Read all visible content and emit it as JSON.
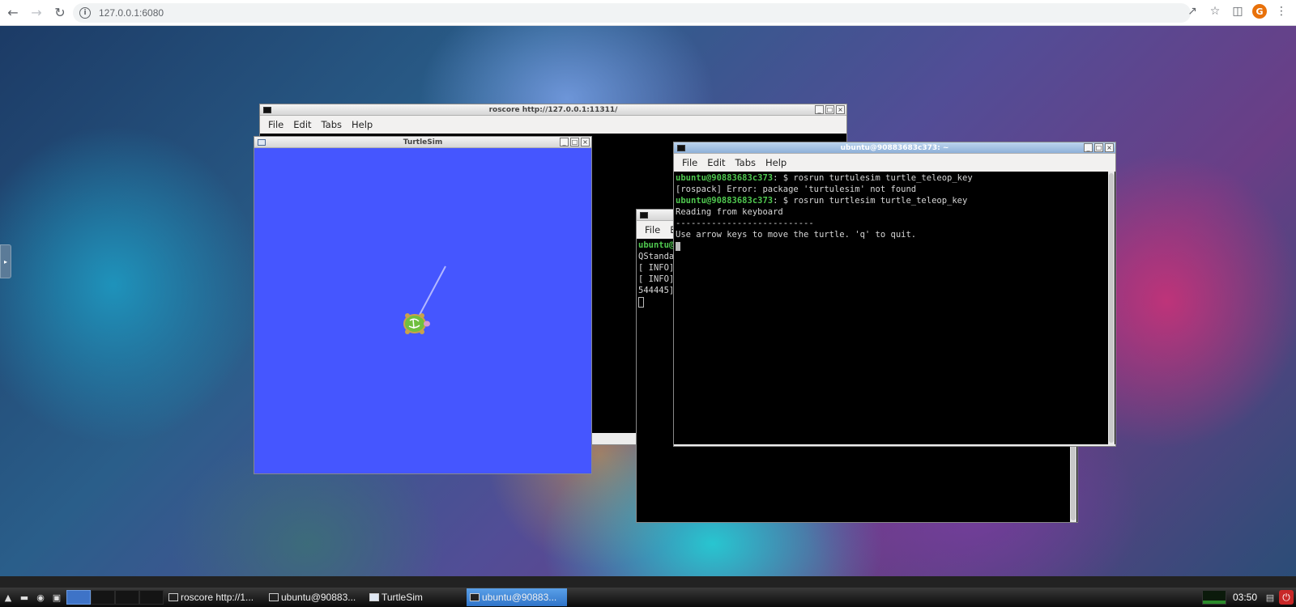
{
  "browser": {
    "url": "127.0.0.1:6080",
    "profile_initial": "G",
    "icons": [
      "back-arrow-icon",
      "forward-arrow-icon",
      "reload-icon",
      "info-icon",
      "share-icon",
      "star-icon",
      "side-panel-icon",
      "menu-kebab-icon"
    ]
  },
  "desktop": {
    "side_handle_icon": "expand-arrow-icon"
  },
  "windows": {
    "roscore": {
      "title": "roscore http://127.0.0.1:11311/",
      "menu": [
        "File",
        "Edit",
        "Tabs",
        "Help"
      ]
    },
    "turtlesim": {
      "title": "TurtleSim",
      "background": "#4556ff",
      "pen_color": "#b3b8ff"
    },
    "middle_terminal": {
      "menu": [
        "File",
        "E"
      ],
      "lines": [
        "ubuntu@",
        "QStanda",
        "[ INFO]",
        "[ INFO]",
        "544445]"
      ]
    },
    "front_terminal": {
      "title": "ubuntu@90883683c373: ~",
      "menu": [
        "File",
        "Edit",
        "Tabs",
        "Help"
      ],
      "line1_prompt": "ubuntu@90883683c373",
      "line1_cmd": ": $ rosrun turtulesim turtle_teleop_key",
      "line2": "[rospack] Error: package 'turtulesim' not found",
      "line3_prompt": "ubuntu@90883683c373",
      "line3_cmd": ": $ rosrun turtlesim turtle_teleop_key",
      "line4": "Reading from keyboard",
      "line5": "---------------------------",
      "line6": "Use arrow keys to move the turtle. 'q' to quit."
    }
  },
  "taskbar": {
    "tasks": [
      {
        "label": "roscore http://1..."
      },
      {
        "label": "ubuntu@90883..."
      },
      {
        "label": "TurtleSim"
      },
      {
        "label": "ubuntu@90883..."
      }
    ],
    "active_task": 3,
    "clock": "03:50",
    "accent": "#3e73c7"
  }
}
